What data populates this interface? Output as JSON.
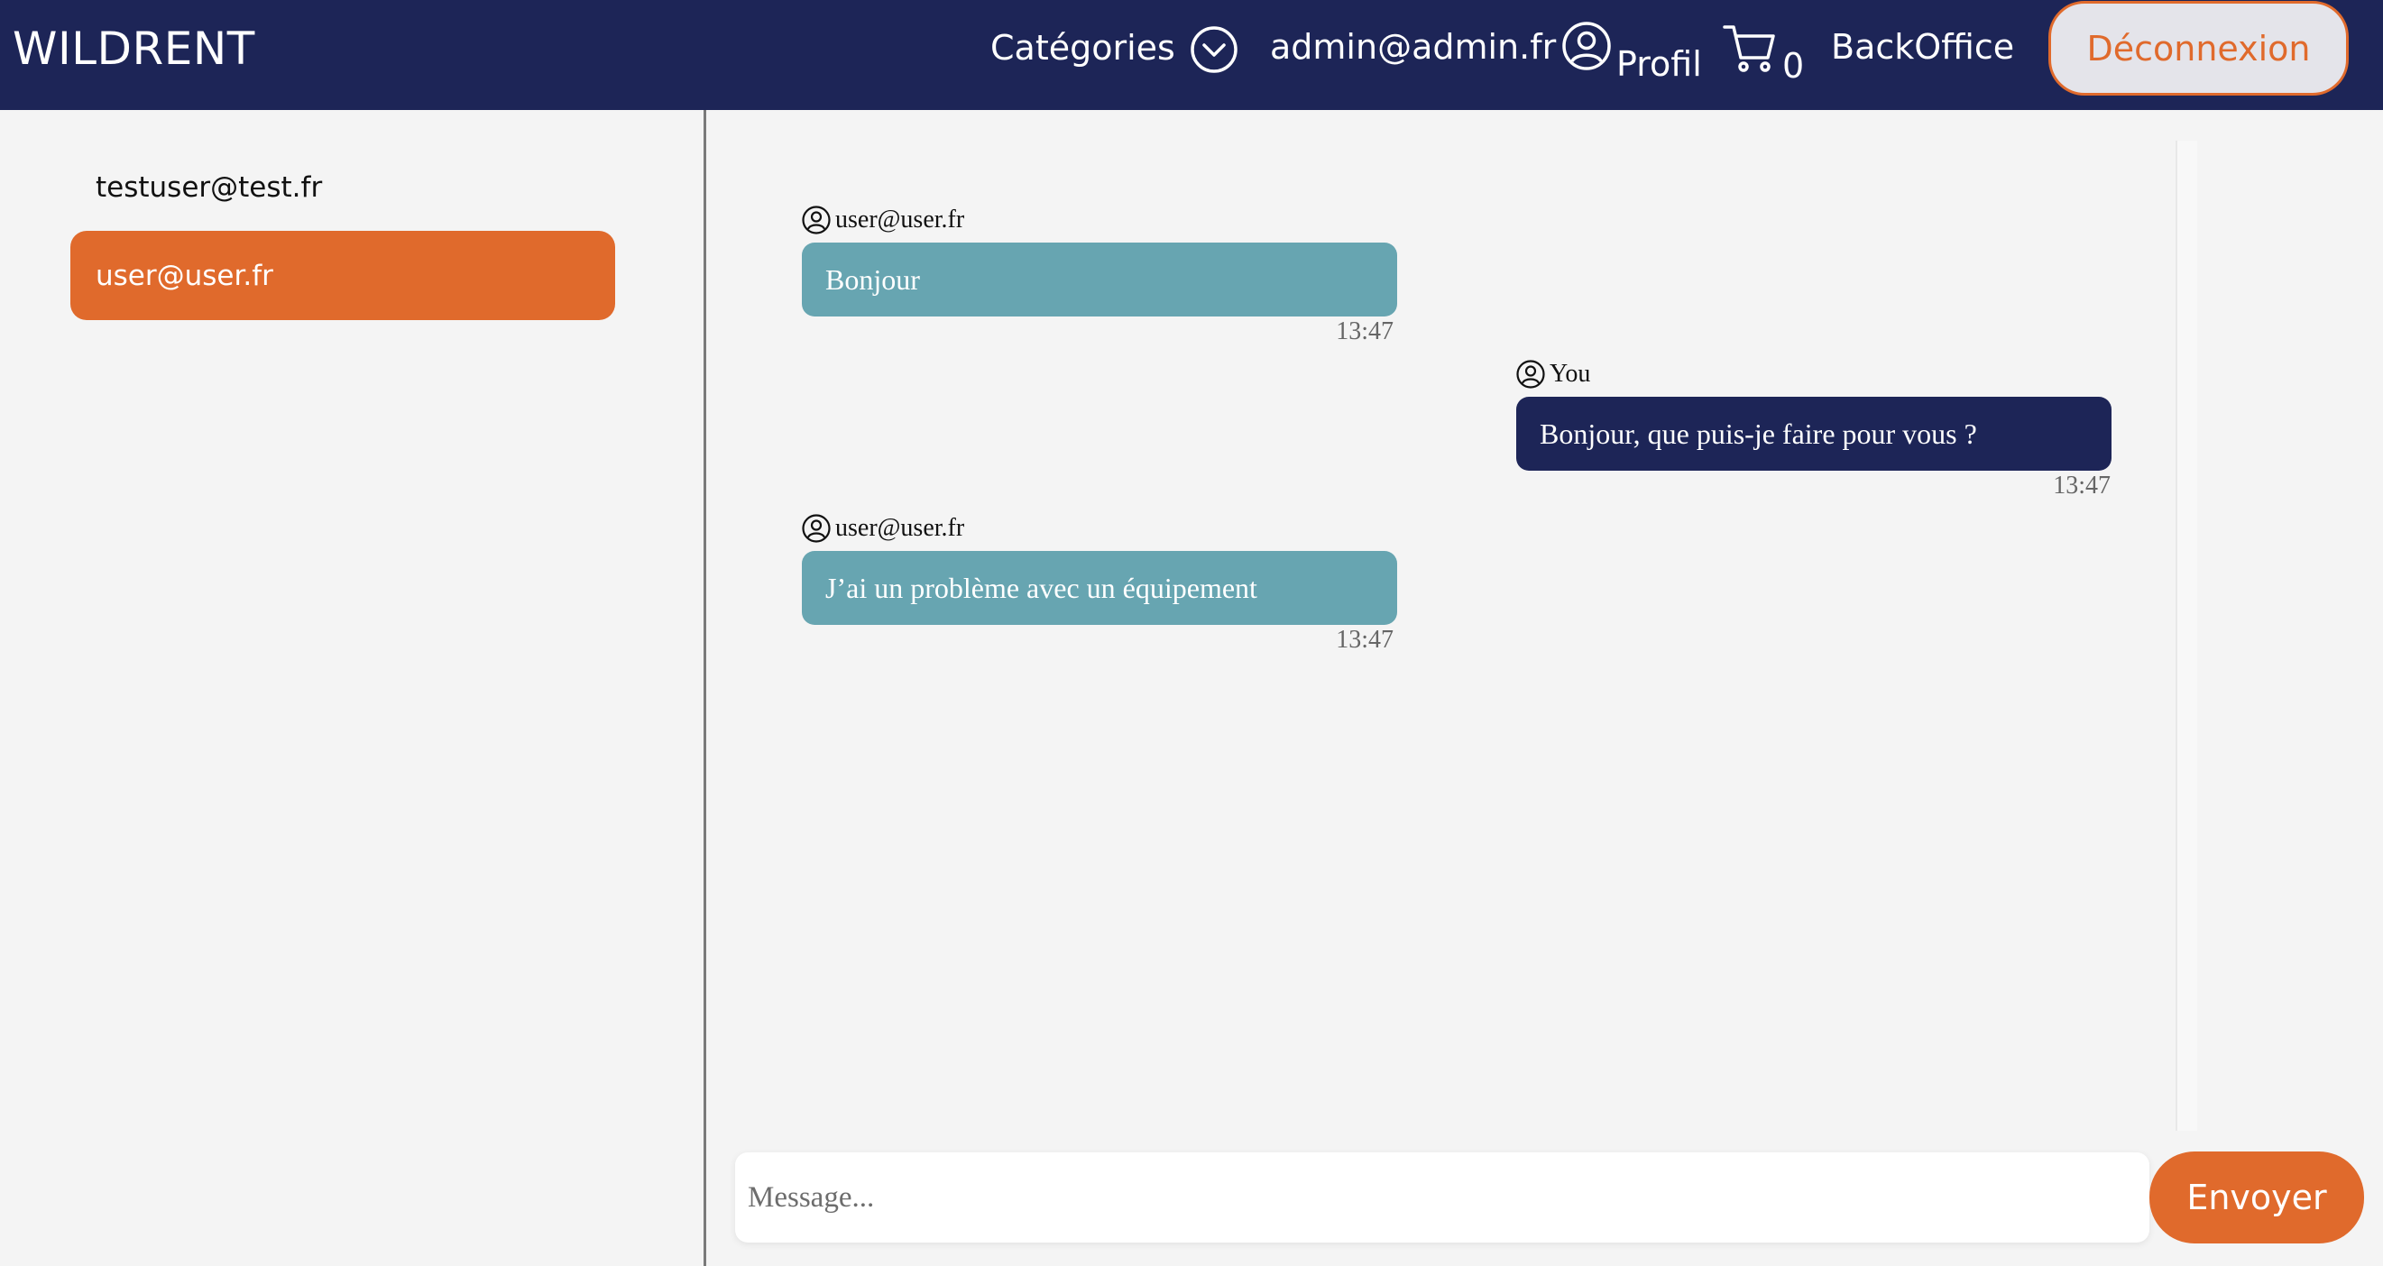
{
  "header": {
    "brand": "WILDRENT",
    "categories_label": "Catégories",
    "user_email": "admin@admin.fr",
    "profile_label": "Profil",
    "cart_count": "0",
    "backoffice_label": "BackOffice",
    "logout_label": "Déconnexion"
  },
  "sidebar": {
    "conversations": [
      {
        "label": "testuser@test.fr",
        "active": false
      },
      {
        "label": "user@user.fr",
        "active": true
      }
    ]
  },
  "chat": {
    "messages": [
      {
        "author": "user@user.fr",
        "text": "Bonjour",
        "time": "13:47",
        "from_me": false
      },
      {
        "author": "You",
        "text": "Bonjour, que puis-je faire pour vous ?",
        "time": "13:47",
        "from_me": true
      },
      {
        "author": "user@user.fr",
        "text": "J’ai un problème avec un équipement",
        "time": "13:47",
        "from_me": false
      }
    ],
    "input_placeholder": "Message...",
    "send_label": "Envoyer"
  },
  "colors": {
    "header_bg": "#1d2557",
    "accent": "#e06a2c",
    "incoming_bubble": "#67a5b1",
    "outgoing_bubble": "#1d2557"
  },
  "icons": [
    "chevron-down-circle-icon",
    "user-circle-icon",
    "cart-icon"
  ]
}
